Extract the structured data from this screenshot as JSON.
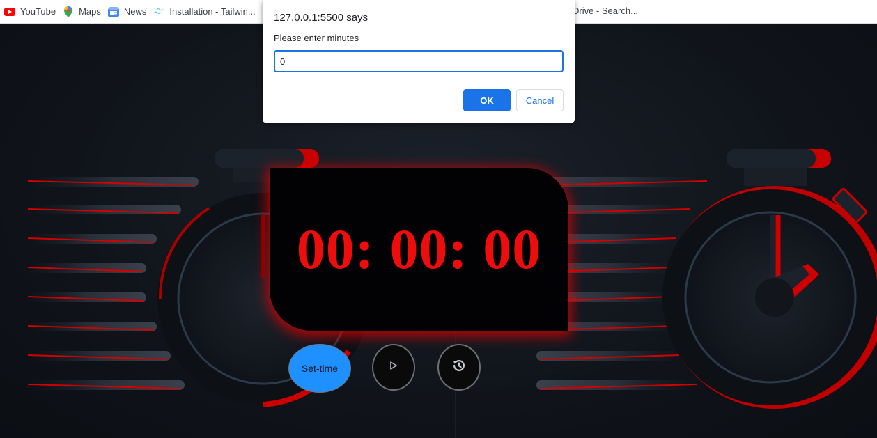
{
  "bookmarks": [
    {
      "label": "YouTube",
      "icon": "youtube-icon"
    },
    {
      "label": "Maps",
      "icon": "maps-icon"
    },
    {
      "label": "News",
      "icon": "news-icon"
    },
    {
      "label": "Installation - Tailwin...",
      "icon": "tailwind-icon"
    }
  ],
  "bookmark_partial": "Drive - Search...",
  "timer": {
    "display": "00: 00: 00",
    "set_label": "Set-time",
    "play_icon": "play-icon",
    "reset_icon": "history-reset-icon"
  },
  "dialog": {
    "title": "127.0.0.1:5500 says",
    "message": "Please enter minutes",
    "input_value": "0",
    "ok_label": "OK",
    "cancel_label": "Cancel"
  },
  "colors": {
    "accent": "#1a73e8",
    "timer_red": "#ee0c0c",
    "set_button": "#1e90ff"
  }
}
